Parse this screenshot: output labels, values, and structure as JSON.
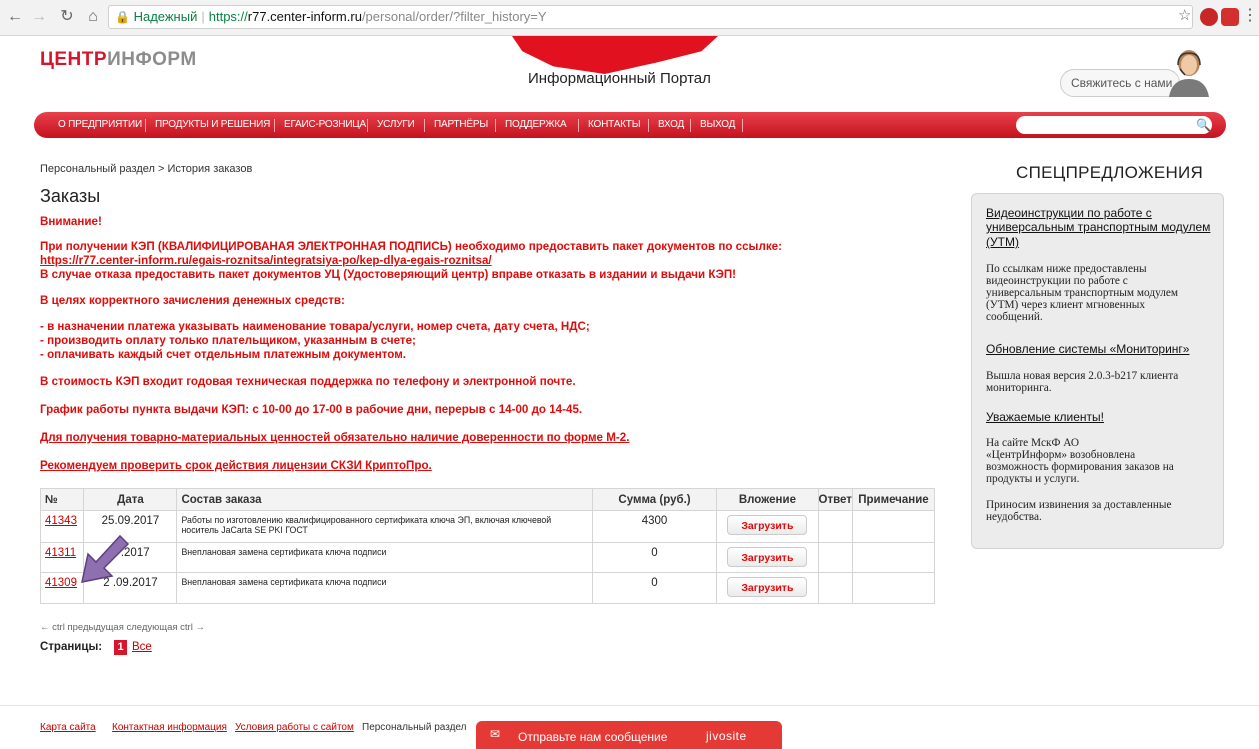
{
  "browser": {
    "secure_label": "Надежный",
    "url_proto": "https://",
    "url_host": "r77.center-inform.ru",
    "url_path": "/personal/order/?filter_history=Y"
  },
  "header": {
    "logo_part1": "ЦЕНТР",
    "logo_part2": "ИНФОРМ",
    "portal_title": "Информационный Портал",
    "contact_button": "Свяжитесь с нами"
  },
  "nav": {
    "items": [
      "О ПРЕДПРИЯТИИ",
      "ПРОДУКТЫ И РЕШЕНИЯ",
      "ЕГАИС-РОЗНИЦА",
      "УСЛУГИ",
      "ПАРТНЁРЫ",
      "ПОДДЕРЖКА",
      "КОНТАКТЫ",
      "ВХОД",
      "ВЫХОД"
    ]
  },
  "breadcrumb": {
    "root": "Персональный раздел",
    "separator": ">",
    "current": "История заказов"
  },
  "page_title": "Заказы",
  "notice": {
    "attention": "Внимание!",
    "kep_line1": "При получении КЭП (КВАЛИФИЦИРОВАНАЯ ЭЛЕКТРОННАЯ ПОДПИСЬ) необходимо предоставить пакет документов по ссылке:",
    "kep_link": "https://r77.center-inform.ru/egais-roznitsa/integratsiya-po/kep-dlya-egais-roznitsa/",
    "kep_line3": "В случае отказа предоставить пакет документов УЦ (Удостоверяющий центр) вправе отказать в издании и выдачи КЭП!",
    "payment_head": "В целях корректного зачисления денежных средств:",
    "payment_rule1": "- в назначении платежа указывать наименование товара/услуги, номер счета, дату счета, НДС;",
    "payment_rule2": "- производить оплату только плательщиком, указанным в счете;",
    "payment_rule3": "- оплачивать каждый счет отдельным платежным документом.",
    "support": "В стоимость КЭП входит годовая техническая поддержка по телефону и электронной почте.",
    "schedule": "График работы пункта выдачи КЭП: с 10-00 до 17-00 в рабочие дни, перерыв с 14-00 до 14-45.",
    "proxy_link": "Для получения товарно-материальных ценностей обязательно наличие доверенности по форме М-2.",
    "license_link": "Рекомендуем проверить срок действия лицензии СКЗИ КриптоПро."
  },
  "table": {
    "headers": [
      "№",
      "Дата",
      "Состав заказа",
      "Сумма (руб.)",
      "Вложение",
      "Ответ",
      "Примечание"
    ],
    "upload_label": "Загрузить",
    "rows": [
      {
        "num": "41343",
        "date": "25.09.2017",
        "composition": "Работы по изготовлению квалифицированного сертификата ключа ЭП, включая ключевой носитель JaCarta SE PKI ГОСТ",
        "sum": "4300"
      },
      {
        "num": "41311",
        "date": "2 .2017",
        "composition": "Внеплановая замена сертификата ключа подписи",
        "sum": "0"
      },
      {
        "num": "41309",
        "date": "2 .09.2017",
        "composition": "Внеплановая замена сертификата ключа подписи",
        "sum": "0"
      }
    ]
  },
  "pager": {
    "nav_text": "← ctrl предыдущая следующая ctrl →",
    "pages_label": "Страницы:",
    "current_page": "1",
    "all_label": "Все"
  },
  "sidebar": {
    "title": "СПЕЦПРЕДЛОЖЕНИЯ",
    "item1_link_line1": "Видеоинструкции по работе с",
    "item1_link_line2": "универсальным транспортным модулем",
    "item1_link_line3": "(УТМ)",
    "item1_text": [
      "По ссылкам ниже предоставлены",
      "видеоинструкции по работе с",
      "универсальным транспортным модулем",
      "(УТМ) через клиент мгновенных",
      "сообщений."
    ],
    "item2_link": "Обновление системы «Мониторинг»",
    "item2_text": [
      "Вышла новая версия 2.0.3-b217 клиента",
      "мониторинга."
    ],
    "item3_link": "Уважаемые клиенты!",
    "item3_text": [
      "На сайте МскФ АО",
      "«ЦентрИнформ» возобновлена",
      "возможность формирования заказов на",
      "продукты и услуги."
    ],
    "item3_text2": [
      "Приносим извинения за доставленные",
      "неудобства."
    ]
  },
  "footer": {
    "links": [
      "Карта сайта",
      "Контактная информация",
      "Условия работы с сайтом"
    ],
    "personal": "Персональный раздел",
    "chat_label": "Отправьте нам сообщение",
    "chat_brand": "jivosite"
  },
  "colors": {
    "brand_red": "#d7152c",
    "notice_red": "#e00b0b",
    "arrow_purple": "#8e6fb0"
  }
}
